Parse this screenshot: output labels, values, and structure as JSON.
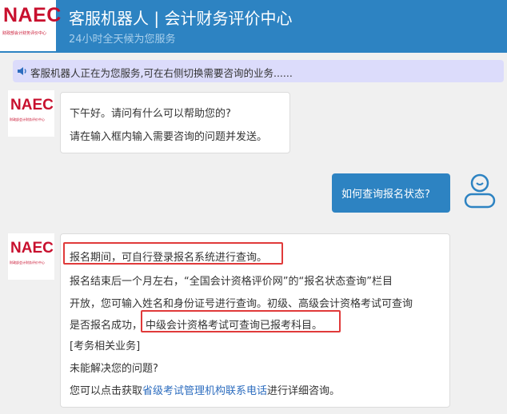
{
  "header": {
    "logo_text": "NAEC",
    "logo_sub": "财政部会计财务评价中心",
    "title": "客服机器人 | 会计财务评价中心",
    "subtitle": "24小时全天候为您服务"
  },
  "notice": {
    "icon": "speaker-icon",
    "text": "客服机器人正在为您服务,可在右侧切换需要咨询的业务......"
  },
  "bot_avatar": {
    "logo_text": "NAEC",
    "logo_sub": "财政部会计财务评价中心"
  },
  "greeting": {
    "line1": "下午好。请问有什么可以帮助您的?",
    "line2": "请在输入框内输入需要咨询的问题并发送。"
  },
  "user_message": {
    "text": "如何查询报名状态?",
    "avatar_icon": "user-icon"
  },
  "answer": {
    "line1": "报名期间，可自行登录报名系统进行查询。",
    "line2": "报名结束后一个月左右，“全国会计资格评价网”的“报名状态查询”栏目",
    "line3": "开放，您可输入姓名和身份证号进行查询。初级、高级会计资格考试可查询",
    "line4_a": "是否报名成功，",
    "line4_b": "中级会计资格考试可查询已报考科目。",
    "related_link": "[考务相关业务]",
    "unresolved": "未能解决您的问题?",
    "contact_prefix": "您可以点击获取",
    "contact_link": "省级考试管理机构联系电话",
    "contact_suffix": "进行详细咨询。"
  },
  "colors": {
    "header_bg": "#2d83c2",
    "logo_red": "#c8102e",
    "highlight_red": "#e03a3a",
    "notice_bg": "#dcdcfb",
    "link_blue": "#2d6dbf"
  }
}
